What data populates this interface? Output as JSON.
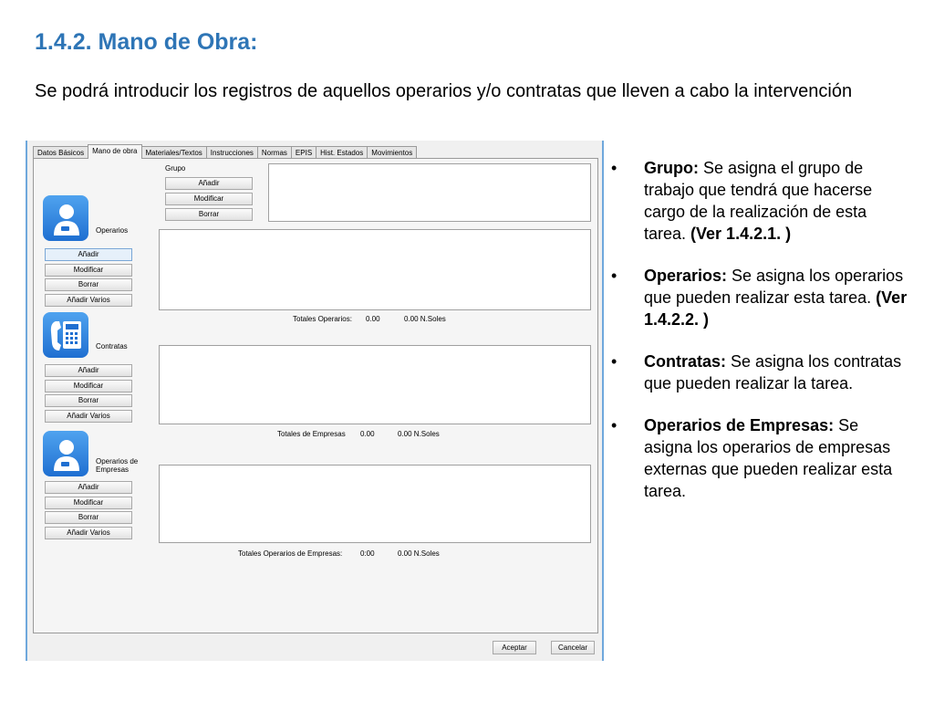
{
  "slide": {
    "title": "1.4.2. Mano de Obra:",
    "subtitle": "Se podrá introducir los registros de aquellos operarios y/o contratas que lleven a cabo la intervención"
  },
  "window": {
    "tabs": [
      "Datos Básicos",
      "Mano de obra",
      "Materiales/Textos",
      "Instrucciones",
      "Normas",
      "EPIS",
      "Hist. Estados",
      "Movimientos"
    ],
    "active_tab": "Mano de obra",
    "grupo": {
      "label": "Grupo",
      "buttons": [
        "Añadir",
        "Modificar",
        "Borrar"
      ]
    },
    "operarios": {
      "label": "Operarios",
      "icon": "user-icon",
      "buttons": [
        "Añadir",
        "Modificar",
        "Borrar",
        "Añadir Varios"
      ],
      "totals_label": "Totales Operarios:",
      "totals_value1": "0.00",
      "totals_value2": "0.00 N.Soles"
    },
    "contratas": {
      "label": "Contratas",
      "icon": "phone-icon",
      "buttons": [
        "Añadir",
        "Modificar",
        "Borrar",
        "Añadir Varios"
      ],
      "totals_label": "Totales de Empresas",
      "totals_value1": "0.00",
      "totals_value2": "0.00 N.Soles"
    },
    "operarios_empresas": {
      "label_line1": "Operarios de",
      "label_line2": "Empresas",
      "icon": "user-icon",
      "buttons": [
        "Añadir",
        "Modificar",
        "Borrar",
        "Añadir Varios"
      ],
      "totals_label": "Totales Operarios de Empresas:",
      "totals_value1": "0:00",
      "totals_value2": "0.00 N.Soles"
    },
    "footer": {
      "accept_label": "Aceptar",
      "cancel_label": "Cancelar"
    },
    "colors": {
      "icon_tile": "#2f86e0",
      "window_border": "#6fa8dc"
    }
  },
  "bullets": [
    {
      "term": "Grupo:",
      "text": " Se asigna el grupo de trabajo que tendrá que hacerse cargo de la realización de esta tarea.  ",
      "ref": "(Ver 1.4.2.1. )"
    },
    {
      "term": "Operarios:",
      "text": " Se asigna los operarios que pueden realizar esta tarea. ",
      "ref": "(Ver 1.4.2.2. )"
    },
    {
      "term": "Contratas:",
      "text": " Se asigna los contratas que pueden realizar la tarea.",
      "ref": ""
    },
    {
      "term": "Operarios de Empresas:",
      "text": " Se asigna los operarios de empresas externas que pueden realizar esta tarea.",
      "ref": ""
    }
  ]
}
